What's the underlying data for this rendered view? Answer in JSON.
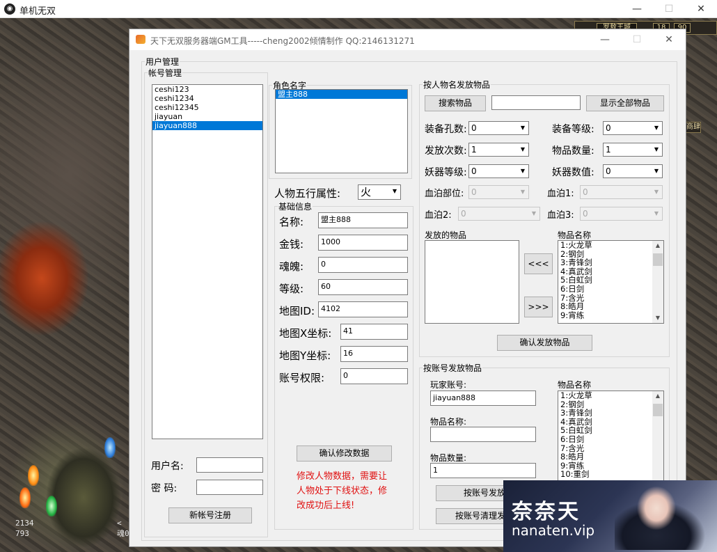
{
  "outer_window": {
    "title": "单机无双",
    "minimize": "—",
    "maximize": "☐",
    "close": "✕",
    "hud": {
      "location": "罗敖王城",
      "v1": "18",
      "v2": "90",
      "side": "商肆"
    },
    "stats": {
      "hp": "2134",
      "hp2": "793",
      "mp_prefix": "<",
      "mp2": "魂0"
    }
  },
  "gm_window": {
    "title": "天下无双服务器端GM工具-----cheng2002倾情制作  QQ:2146131271",
    "minimize": "—",
    "maximize": "☐",
    "close": "✕"
  },
  "user_mgmt": {
    "legend": "用户管理",
    "account_legend": "帐号管理",
    "accounts": [
      "ceshi123",
      "ceshi1234",
      "ceshi12345",
      "jiayuan",
      "jiayuan888"
    ],
    "selected_account_index": 4,
    "username_label": "用户名:",
    "password_label": "密  码:",
    "username_value": "",
    "password_value": "",
    "register_button": "新帐号注册"
  },
  "character": {
    "legend": "角色名字",
    "names": [
      "盟主888"
    ],
    "selected_index": 0,
    "five_elements_label": "人物五行属性:",
    "five_elements_value": "火",
    "basic_legend": "基础信息",
    "fields": [
      {
        "label": "名称:",
        "value": "盟主888"
      },
      {
        "label": "金钱:",
        "value": "1000"
      },
      {
        "label": "魂魄:",
        "value": "0"
      },
      {
        "label": "等级:",
        "value": "60"
      },
      {
        "label": "地图ID:",
        "value": "4102"
      },
      {
        "label": "地图X坐标:",
        "value": "41"
      },
      {
        "label": "地图Y坐标:",
        "value": "16"
      },
      {
        "label": "账号权限:",
        "value": "0"
      }
    ],
    "confirm_button": "确认修改数据",
    "note_lines": [
      "修改人物数据，需要让",
      "人物处于下线状态，修",
      "改成功后上线!"
    ]
  },
  "item_by_name": {
    "legend": "按人物名发放物品",
    "search_button": "搜索物品",
    "search_value": "",
    "show_all_button": "显示全部物品",
    "combos": [
      {
        "label": "装备孔数:",
        "value": "0",
        "disabled": false
      },
      {
        "label": "装备等级:",
        "value": "0",
        "disabled": false
      },
      {
        "label": "发放次数:",
        "value": "1",
        "disabled": false
      },
      {
        "label": "物品数量:",
        "value": "1",
        "disabled": false
      },
      {
        "label": "妖器等级:",
        "value": "0",
        "disabled": false
      },
      {
        "label": "妖器数值:",
        "value": "0",
        "disabled": false
      },
      {
        "label": "血泊部位:",
        "value": "0",
        "disabled": true
      },
      {
        "label": "血泊1:",
        "value": "0",
        "disabled": true
      },
      {
        "label": "血泊2:",
        "value": "0",
        "disabled": true
      },
      {
        "label": "血泊3:",
        "value": "0",
        "disabled": true
      }
    ],
    "issued_label": "发放的物品",
    "item_name_label": "物品名称",
    "left_button": "<<<",
    "right_button": ">>>",
    "items": [
      "1:火龙草",
      "2:钢剑",
      "3:青锋剑",
      "4:真武剑",
      "5:白虹剑",
      "6:日剑",
      "7:含光",
      "8:皓月",
      "9:宵练"
    ],
    "confirm_button": "确认发放物品"
  },
  "item_by_account": {
    "legend": "按账号发放物品",
    "player_account_label": "玩家账号:",
    "player_account_value": "jiayuan888",
    "item_name_field_label": "物品名称:",
    "item_name_value": "",
    "item_qty_label": "物品数量:",
    "item_qty_value": "1",
    "list_label": "物品名称",
    "items": [
      "1:火龙草",
      "2:钢剑",
      "3:青锋剑",
      "4:真武剑",
      "5:白虹剑",
      "6:日剑",
      "7:含光",
      "8:皓月",
      "9:宵练",
      "10:重剑"
    ],
    "issue_button": "按账号发放",
    "clear_button": "按账号清理发放"
  },
  "watermark": {
    "title": "奈奈天",
    "url": "nanaten.vip"
  }
}
